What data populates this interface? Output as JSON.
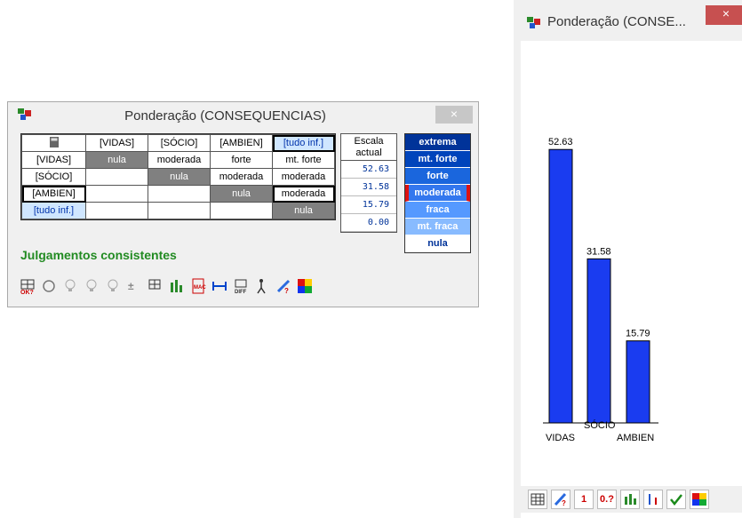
{
  "main_window": {
    "title": "Ponderação (CONSEQUENCIAS)",
    "close": "×",
    "matrix": {
      "corner_icon": "calculator-icon",
      "headers": [
        "[VIDAS]",
        "[SÓCIO]",
        "[AMBIEN]",
        "[tudo inf.]"
      ],
      "rows": [
        {
          "label": "[VIDAS]",
          "cells": [
            "nula",
            "moderada",
            "forte",
            "mt. forte"
          ]
        },
        {
          "label": "[SÓCIO]",
          "cells": [
            "",
            "nula",
            "moderada",
            "moderada"
          ]
        },
        {
          "label": "[AMBIEN]",
          "cells": [
            "",
            "",
            "nula",
            "moderada"
          ]
        },
        {
          "label": "[tudo inf.]",
          "cells": [
            "",
            "",
            "",
            "nula"
          ]
        }
      ]
    },
    "escala": {
      "header_line1": "Escala",
      "header_line2": "actual",
      "values": [
        "52.63",
        "31.58",
        "15.79",
        "0.00"
      ]
    },
    "scale_levels": [
      {
        "label": "extrema",
        "color": "#003399"
      },
      {
        "label": "mt. forte",
        "color": "#0044bb"
      },
      {
        "label": "forte",
        "color": "#1a66dd"
      },
      {
        "label": "moderada",
        "color": "#3377ee"
      },
      {
        "label": "fraca",
        "color": "#5599ff"
      },
      {
        "label": "mt. fraca",
        "color": "#88bbff"
      },
      {
        "label": "nula",
        "color": "#ffffff"
      }
    ],
    "status": "Julgamentos consistentes",
    "toolbar_icons": [
      "grid-ok-icon",
      "refresh-icon",
      "bulb-icon",
      "bulb-question-icon",
      "bulb-ok-icon",
      "plus-minus-icon",
      "grid-arrow-icon",
      "bar-chart-icon",
      "macbeth-icon",
      "range-icon",
      "diff-icon",
      "person-icon",
      "question-edit-icon",
      "color-palette-icon"
    ]
  },
  "chart_window": {
    "title": "Ponderação (CONSE...",
    "close": "×",
    "toolbar_labels": [
      "1",
      "0.?"
    ],
    "toolbar_icons": [
      "grid-icon",
      "question-edit-icon",
      "one-icon",
      "zero-question-icon",
      "bars-icon",
      "sort-icon",
      "check-icon",
      "palette-icon"
    ]
  },
  "chart_data": {
    "type": "bar",
    "categories": [
      "VIDAS",
      "SÓCIO",
      "AMBIEN"
    ],
    "values": [
      52.63,
      31.58,
      15.79
    ],
    "value_labels": [
      "52.63",
      "31.58",
      "15.79"
    ],
    "bar_color": "#1a3cf0",
    "ylim": [
      0,
      60
    ]
  }
}
